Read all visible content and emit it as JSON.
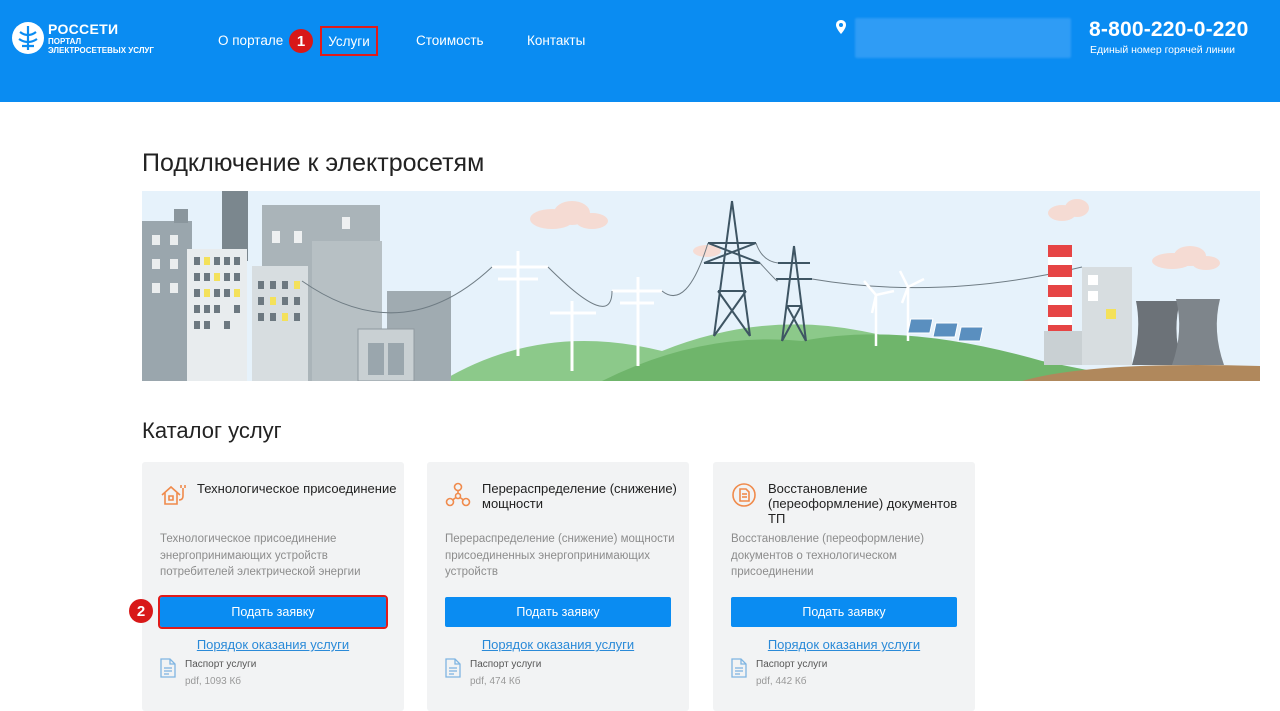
{
  "header": {
    "logo_title": "РОССЕТИ",
    "logo_sub_1": "ПОРТАЛ",
    "logo_sub_2": "ЭЛЕКТРОСЕТЕВЫХ УСЛУГ",
    "nav": {
      "about": "О портале",
      "services": "Услуги",
      "cost": "Стоимость",
      "contacts": "Контакты"
    },
    "phone": "8-800-220-0-220",
    "phone_caption": "Единый номер горячей линии"
  },
  "annotations": {
    "step1": "1",
    "step2": "2"
  },
  "page_title": "Подключение к электросетям",
  "catalog_title": "Каталог услуг",
  "cards": [
    {
      "title": "Технологическое присоединение",
      "description": "Технологическое присоединение энергопринимающих устройств потребителей электрической энергии",
      "button": "Подать заявку",
      "link": "Порядок оказания услуги",
      "doc_name": "Паспорт услуги",
      "doc_meta": "pdf, 1093 Кб"
    },
    {
      "title": "Перераспределение (снижение) мощности",
      "description": "Перераспределение (снижение) мощности присоединенных энергопринимающих устройств",
      "button": "Подать заявку",
      "link": "Порядок оказания услуги",
      "doc_name": "Паспорт услуги",
      "doc_meta": "pdf, 474 Кб"
    },
    {
      "title": "Восстановление (переоформление) документов ТП",
      "description": "Восстановление (переоформление) документов о технологическом присоединении",
      "button": "Подать заявку",
      "link": "Порядок оказания услуги",
      "doc_name": "Паспорт услуги",
      "doc_meta": "pdf, 442 Кб"
    }
  ],
  "colors": {
    "brand": "#0a8cf2",
    "highlight": "#e01b1b",
    "icon_orange": "#f08a4b"
  }
}
